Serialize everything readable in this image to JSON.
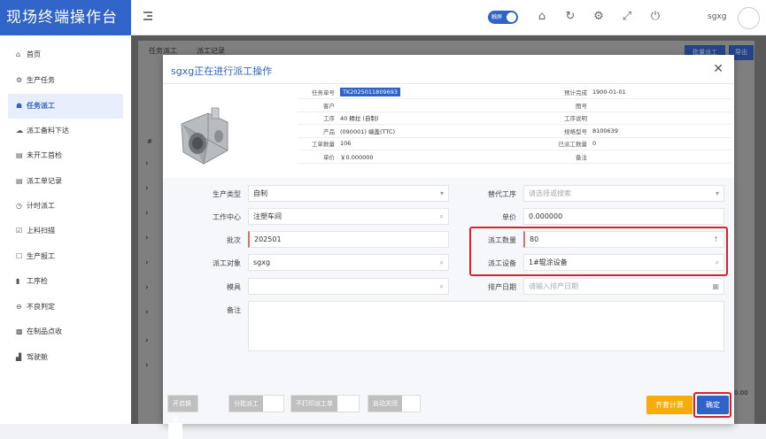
{
  "app_title": "现场终端操作台",
  "header": {
    "touch_label": "触屏",
    "user": "sgxg"
  },
  "sidebar": {
    "items": [
      {
        "label": "首页",
        "icon": "home-icon"
      },
      {
        "label": "生产任务",
        "icon": "gears-icon"
      },
      {
        "label": "任务派工",
        "icon": "sitemap-icon"
      },
      {
        "label": "派工备料下达",
        "icon": "cloud-download-icon"
      },
      {
        "label": "未开工首检",
        "icon": "id-card-icon"
      },
      {
        "label": "派工单记录",
        "icon": "id-card-icon"
      },
      {
        "label": "计时派工",
        "icon": "clock-icon"
      },
      {
        "label": "上料扫描",
        "icon": "check-square-icon"
      },
      {
        "label": "生产报工",
        "icon": "square-icon"
      },
      {
        "label": "工序检",
        "icon": "cylinder-icon"
      },
      {
        "label": "不良判定",
        "icon": "search-minus-icon"
      },
      {
        "label": "在制品点收",
        "icon": "archive-icon"
      },
      {
        "label": "驾驶舱",
        "icon": "chart-icon"
      }
    ]
  },
  "background": {
    "tabs": [
      "任务派工",
      "派工记录"
    ],
    "buttons": [
      "批量派工",
      "导出"
    ],
    "col_marker": "#",
    "right_value": "0.00"
  },
  "modal": {
    "title": "sgxg正在进行派工操作",
    "info": [
      {
        "l1": "任务单号",
        "v1": "TK2025011809693",
        "l2": "预计完成",
        "v2": "1900-01-01"
      },
      {
        "l1": "客户",
        "v1": "",
        "l2": "图号",
        "v2": ""
      },
      {
        "l1": "工序",
        "v1": "40 精拉 (自制)",
        "l2": "工序说明",
        "v2": ""
      },
      {
        "l1": "产品",
        "v1": "(090001) 端盖(TTC)",
        "l2": "规格型号",
        "v2": "8100639"
      },
      {
        "l1": "工单数量",
        "v1": "106",
        "l2": "已派工数量",
        "v2": "0"
      },
      {
        "l1": "单价",
        "v1": "￥0.000000",
        "l2": "备注",
        "v2": ""
      }
    ],
    "form": {
      "prod_type_label": "生产类型",
      "prod_type": "自制",
      "alt_proc_label": "替代工序",
      "alt_proc_ph": "请选择或搜索",
      "work_center_label": "工作中心",
      "work_center": "注塑车间",
      "unit_price_label": "单价",
      "unit_price": "0.000000",
      "batch_label": "批次",
      "batch": "202501",
      "qty_label": "派工数量",
      "qty": "80",
      "target_label": "派工对象",
      "target": "sgxg",
      "device_label": "派工设备",
      "device": "1#辊涂设备",
      "mold_label": "模具",
      "mold": "",
      "date_label": "排产日期",
      "date_ph": "请输入排产日期",
      "remark_label": "备注",
      "remark": ""
    },
    "bottom": [
      "开启换算",
      "分批派工",
      "不打印派工单",
      "自动关闭"
    ],
    "calc_button": "齐套计算",
    "ok_button": "确定"
  }
}
